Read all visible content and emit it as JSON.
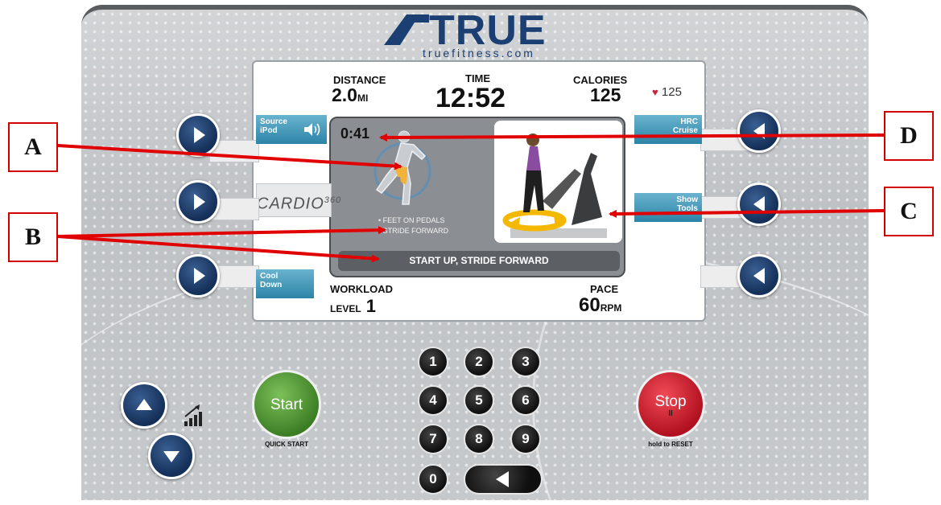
{
  "brand": {
    "name": "TRUE",
    "url": "truefitness.com"
  },
  "stats": {
    "distance_label": "DISTANCE",
    "distance_value": "2.0",
    "distance_unit": "MI",
    "time_label": "TIME",
    "time_value": "12:52",
    "calories_label": "CALORIES",
    "calories_value": "125",
    "heart_rate": "125",
    "workload_label": "WORKLOAD",
    "level_word": "LEVEL",
    "level_value": "1",
    "pace_label": "PACE",
    "pace_value": "60",
    "pace_unit": "RPM"
  },
  "workout": {
    "segment_timer": "0:41",
    "tip_line1": "• FEET ON PEDALS",
    "tip_line2": "• STRIDE FORWARD",
    "instruction": "START UP, STRIDE FORWARD",
    "program_logo": "CARDIO",
    "program_logo_sup": "360"
  },
  "softkeys": {
    "left": [
      {
        "line1": "Source",
        "line2": "iPod",
        "icon": "speaker-icon"
      },
      {
        "line1": "",
        "line2": ""
      },
      {
        "line1": "Cool",
        "line2": "Down"
      }
    ],
    "right": [
      {
        "line1": "HRC",
        "line2": "Cruise"
      },
      {
        "line1": "Show",
        "line2": "Tools"
      },
      {
        "line1": "",
        "line2": ""
      }
    ]
  },
  "keypad": [
    "1",
    "2",
    "3",
    "4",
    "5",
    "6",
    "7",
    "8",
    "9",
    "0"
  ],
  "buttons": {
    "start_label": "Start",
    "start_caption": "QUICK START",
    "stop_label": "Stop",
    "stop_symbol": "II",
    "stop_caption": "hold to RESET"
  },
  "callouts": [
    "A",
    "B",
    "C",
    "D"
  ],
  "colors": {
    "start_green": "#5aa23a",
    "stop_red": "#d8182b",
    "navy": "#1c3f73",
    "softkey_blue": "#3c92b4",
    "callout_red": "#e00000"
  }
}
